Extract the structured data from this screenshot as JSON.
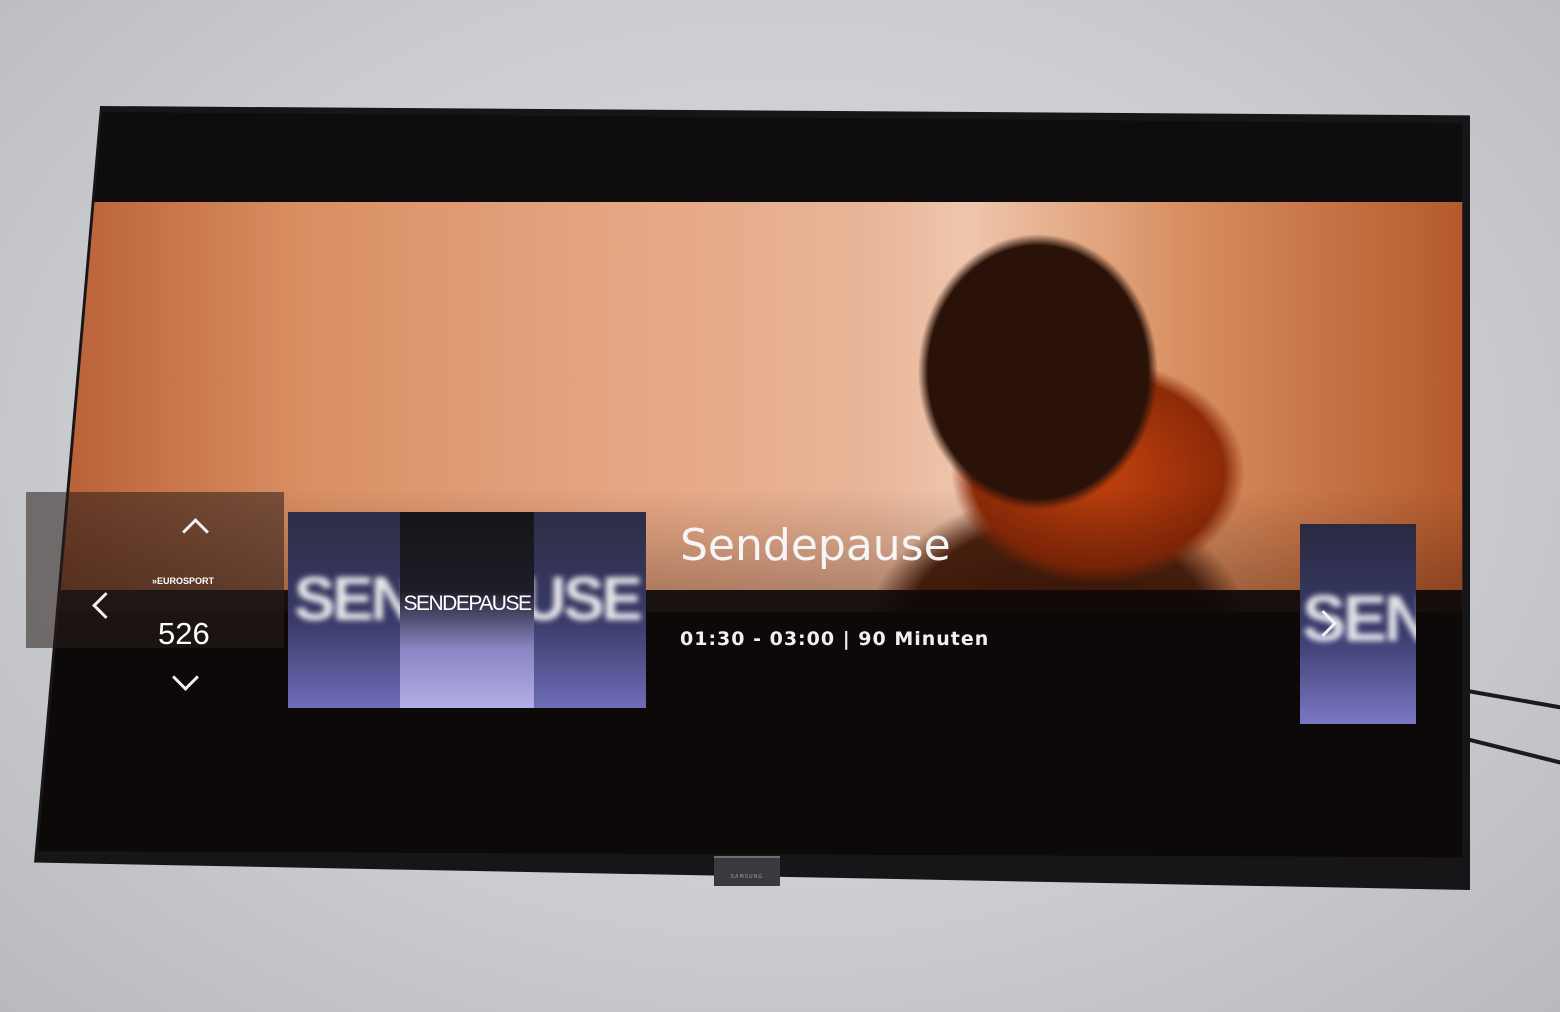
{
  "channel": {
    "logo_text": "»EUROSPORT",
    "number": "526"
  },
  "program": {
    "thumbnail": {
      "left_text": "SEN",
      "center_text": "SENDEPAUSE",
      "right_text": "USE"
    },
    "title": "Sendepause",
    "time_range": "01:30 - 03:00",
    "separator": "|",
    "duration": "90 Minuten"
  },
  "next_program": {
    "thumbnail_text": "SEN"
  },
  "icons": {
    "up": "chevron-up-icon",
    "down": "chevron-down-icon",
    "left": "chevron-left-icon",
    "right": "chevron-right-icon"
  },
  "colors": {
    "overlay_bg": "#0e0a0a",
    "thumbnail_gradient_top": "#2d2d45",
    "thumbnail_gradient_bottom": "#6e6db8",
    "text": "#ffffff"
  }
}
